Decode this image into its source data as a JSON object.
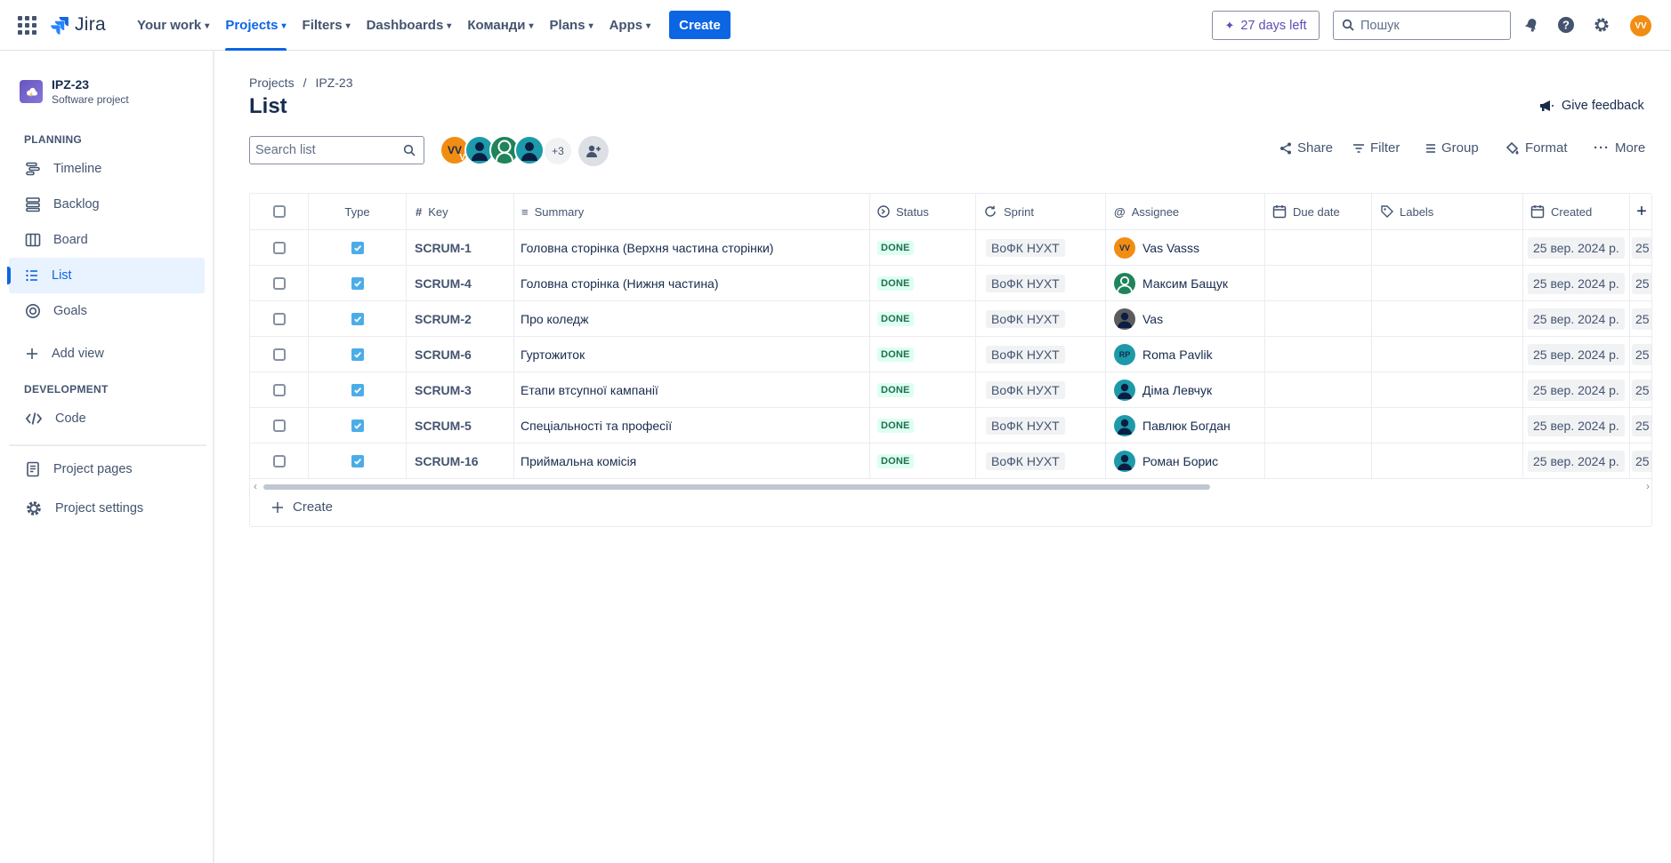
{
  "topnav": {
    "logo_text": "Jira",
    "items": [
      {
        "label": "Your work"
      },
      {
        "label": "Projects"
      },
      {
        "label": "Filters"
      },
      {
        "label": "Dashboards"
      },
      {
        "label": "Команди"
      },
      {
        "label": "Plans"
      },
      {
        "label": "Apps"
      }
    ],
    "create_label": "Create",
    "trial_label": "27 days left",
    "search_placeholder": "Пошук",
    "user_initials": "VV",
    "accent": "#0c66e4"
  },
  "sidebar": {
    "project_name": "IPZ-23",
    "project_type": "Software project",
    "planning_label": "PLANNING",
    "planning_items": [
      {
        "label": "Timeline",
        "icon": "timeline-icon"
      },
      {
        "label": "Backlog",
        "icon": "backlog-icon"
      },
      {
        "label": "Board",
        "icon": "board-icon"
      },
      {
        "label": "List",
        "icon": "list-icon"
      },
      {
        "label": "Goals",
        "icon": "goals-icon"
      }
    ],
    "add_view_label": "Add view",
    "development_label": "DEVELOPMENT",
    "code_label": "Code",
    "project_pages_label": "Project pages",
    "project_settings_label": "Project settings"
  },
  "main": {
    "breadcrumb": [
      "Projects",
      "IPZ-23"
    ],
    "title": "List",
    "feedback_label": "Give feedback",
    "search_placeholder": "Search list",
    "avatars": [
      {
        "initials": "VV",
        "badge": "V",
        "color": "#f18d13"
      },
      {
        "initials": "",
        "color": "#1d7afc"
      },
      {
        "initials": "",
        "color": "#1f845a"
      },
      {
        "initials": "",
        "color": "#1d9aaa"
      }
    ],
    "more_avatars": "+3",
    "toolbar": {
      "share": "Share",
      "filter": "Filter",
      "group": "Group",
      "format": "Format",
      "more": "More"
    }
  },
  "table": {
    "columns": [
      "Type",
      "Key",
      "Summary",
      "Status",
      "Sprint",
      "Assignee",
      "Due date",
      "Labels",
      "Created"
    ],
    "rows": [
      {
        "key": "SCRUM-1",
        "summary": "Головна сторінка (Верхня частина сторінки)",
        "status": "DONE",
        "sprint": "ВоФК НУХТ",
        "assignee": "Vas Vasss",
        "assignee_initials": "VV",
        "assignee_color": "#f18d13",
        "due": "",
        "labels": "",
        "created": "25 вер. 2024 р.",
        "created_next": "25"
      },
      {
        "key": "SCRUM-4",
        "summary": "Головна сторінка (Нижня частина)",
        "status": "DONE",
        "sprint": "ВоФК НУХТ",
        "assignee": "Максим Бащук",
        "assignee_initials": "",
        "assignee_color": "#1f845a",
        "due": "",
        "labels": "",
        "created": "25 вер. 2024 р.",
        "created_next": "25"
      },
      {
        "key": "SCRUM-2",
        "summary": "Про коледж",
        "status": "DONE",
        "sprint": "ВоФК НУХТ",
        "assignee": "Vas",
        "assignee_initials": "",
        "assignee_color": "#5c5c5c",
        "due": "",
        "labels": "",
        "created": "25 вер. 2024 р.",
        "created_next": "25"
      },
      {
        "key": "SCRUM-6",
        "summary": "Гуртожиток",
        "status": "DONE",
        "sprint": "ВоФК НУХТ",
        "assignee": "Roma Pavlik",
        "assignee_initials": "RP",
        "assignee_color": "#1d9aaa",
        "due": "",
        "labels": "",
        "created": "25 вер. 2024 р.",
        "created_next": "25"
      },
      {
        "key": "SCRUM-3",
        "summary": "Етапи втсупної кампанії",
        "status": "DONE",
        "sprint": "ВоФК НУХТ",
        "assignee": "Діма Левчук",
        "assignee_initials": "",
        "assignee_color": "#1d9aaa",
        "due": "",
        "labels": "",
        "created": "25 вер. 2024 р.",
        "created_next": "25"
      },
      {
        "key": "SCRUM-5",
        "summary": "Спеціальності та професії",
        "status": "DONE",
        "sprint": "ВоФК НУХТ",
        "assignee": "Павлюк Богдан",
        "assignee_initials": "",
        "assignee_color": "#1d9aaa",
        "due": "",
        "labels": "",
        "created": "25 вер. 2024 р.",
        "created_next": "25"
      },
      {
        "key": "SCRUM-16",
        "summary": "Приймальна комісія",
        "status": "DONE",
        "sprint": "ВоФК НУХТ",
        "assignee": "Роман Борис",
        "assignee_initials": "",
        "assignee_color": "#1d9aaa",
        "due": "",
        "labels": "",
        "created": "25 вер. 2024 р.",
        "created_next": "25"
      }
    ],
    "create_label": "Create"
  }
}
